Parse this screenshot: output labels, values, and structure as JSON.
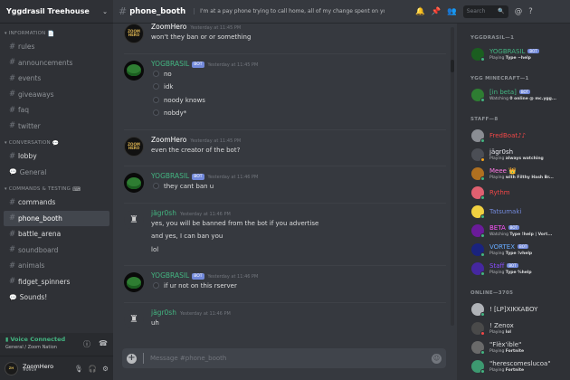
{
  "server": {
    "name": "Yggdrasil Treehouse"
  },
  "categories": [
    {
      "label": "INFORMATION",
      "channels": [
        "rules",
        "announcements",
        "events",
        "giveaways",
        "faq",
        "twitter"
      ]
    },
    {
      "label": "CONVERSATION",
      "channels": [
        "lobby",
        "General"
      ]
    },
    {
      "label": "COMMANDS & TESTING",
      "channels": [
        "commands",
        "phone_booth",
        "battle_arena",
        "soundboard",
        "animals",
        "fidget_spinners",
        "Sounds!"
      ]
    }
  ],
  "channel": {
    "name": "phone_booth",
    "topic": "I'm at a pay phone trying to call home, all of my change spent on you... {-fun}{-...",
    "search_placeholder": "Search"
  },
  "voice": {
    "status": "Voice Connected",
    "location": "General / Zoom Nation"
  },
  "user": {
    "name": "ZoomHero",
    "discriminator": "#0919"
  },
  "composer": {
    "placeholder": "Message #phone_booth"
  },
  "messages": [
    {
      "author": "ZoomHero",
      "bot": false,
      "color": "#ffffff",
      "time": "Yesterday at 11:45 PM",
      "lines": [
        "won't they ban or or something"
      ]
    },
    {
      "author": "YOGBRASIL",
      "bot": true,
      "bot_label": "BOT",
      "color": "#43b581",
      "time": "Yesterday at 11:45 PM",
      "lines": [
        "no",
        "idk",
        "noody knows",
        "nobdy*"
      ]
    },
    {
      "author": "ZoomHero",
      "bot": false,
      "color": "#ffffff",
      "time": "Yesterday at 11:45 PM",
      "lines": [
        "even the creator of the bot?"
      ]
    },
    {
      "author": "YOGBRASIL",
      "bot": true,
      "bot_label": "BOT",
      "color": "#43b581",
      "time": "Yesterday at 11:46 PM",
      "lines": [
        "they cant ban u"
      ]
    },
    {
      "author": "jägr0sh",
      "bot": false,
      "color": "#43b581",
      "time": "Yesterday at 11:46 PM",
      "lines": [
        "yes, you will be banned from the bot if you advertise",
        "and yes, I can ban you",
        "lol"
      ]
    },
    {
      "author": "YOGBRASIL",
      "bot": true,
      "bot_label": "BOT",
      "color": "#43b581",
      "time": "Yesterday at 11:46 PM",
      "lines": [
        "if ur not on this rserver"
      ]
    },
    {
      "author": "jägr0sh",
      "bot": false,
      "color": "#43b581",
      "time": "Yesterday at 11:46 PM",
      "lines": [
        "uh"
      ]
    }
  ],
  "member_groups": [
    {
      "label": "YGGDRASIL—1",
      "members": [
        {
          "name": "YOGBRASIL",
          "bot": true,
          "color": "#43b581",
          "activity": "Playing",
          "activity_bold": "Type ~help",
          "avatar": "#1b5e20",
          "status": "#43b581"
        }
      ]
    },
    {
      "label": "YGG MINECRAFT—1",
      "members": [
        {
          "name": "[in beta]",
          "bot": true,
          "color": "#43b581",
          "activity": "Watching",
          "activity_bold": "0 online @ mc.ygg...",
          "avatar": "#2e7d32",
          "status": "#43b581"
        }
      ]
    },
    {
      "label": "STAFF—8",
      "members": [
        {
          "name": "FredBoat♪♪",
          "bot": false,
          "color": "#f04747",
          "activity": "",
          "activity_bold": "",
          "avatar": "#8a8d93",
          "status": "#43b581"
        },
        {
          "name": "jägr0sh",
          "bot": false,
          "color": "#e9e9f0",
          "activity": "Playing",
          "activity_bold": "always watching",
          "avatar": "#4b4e55",
          "status": "#faa61a"
        },
        {
          "name": "Meee 👑",
          "bot": false,
          "color": "#ff7ae6",
          "activity": "Playing",
          "activity_bold": "with Filthy Hash Br...",
          "avatar": "#b07020",
          "status": "#43b581"
        },
        {
          "name": "Rythm",
          "bot": false,
          "color": "#f04747",
          "activity": "",
          "activity_bold": "",
          "avatar": "#e06070",
          "status": "#43b581"
        },
        {
          "name": "Tatsumaki",
          "bot": false,
          "color": "#7289da",
          "activity": "",
          "activity_bold": "",
          "avatar": "#f0d040",
          "status": "#43b581"
        },
        {
          "name": "BETA",
          "bot": true,
          "color": "#ff55ff",
          "activity": "Watching",
          "activity_bold": "Type !help | Vort...",
          "avatar": "#6a1b9a",
          "status": "#43b581"
        },
        {
          "name": "VORTEX",
          "bot": true,
          "color": "#66aaff",
          "activity": "Playing",
          "activity_bold": "Type !vhelp",
          "avatar": "#1a237e",
          "status": "#43b581"
        },
        {
          "name": "Staff",
          "bot": true,
          "color": "#8a4dff",
          "activity": "Playing",
          "activity_bold": "Type %help",
          "avatar": "#4527a0",
          "status": "#43b581"
        }
      ]
    },
    {
      "label": "ONLINE—3705",
      "members": [
        {
          "name": "! [LP]XIKKABOY",
          "bot": false,
          "color": "#dcddde",
          "activity": "",
          "activity_bold": "",
          "avatar": "#b0b3b8",
          "status": "#43b581"
        },
        {
          "name": "! Zenox",
          "bot": false,
          "color": "#dcddde",
          "activity": "Playing",
          "activity_bold": "lol",
          "avatar": "#4a4a4a",
          "status": "#f04747"
        },
        {
          "name": "\"Flèx'ible\"",
          "bot": false,
          "color": "#dcddde",
          "activity": "Playing",
          "activity_bold": "Fortnite",
          "avatar": "#6a6a6a",
          "status": "#43b581"
        },
        {
          "name": "\"herescomeslucoa\"",
          "bot": false,
          "color": "#dcddde",
          "activity": "Playing",
          "activity_bold": "Fortnite",
          "avatar": "#3d9970",
          "status": "#43b581"
        }
      ]
    }
  ]
}
